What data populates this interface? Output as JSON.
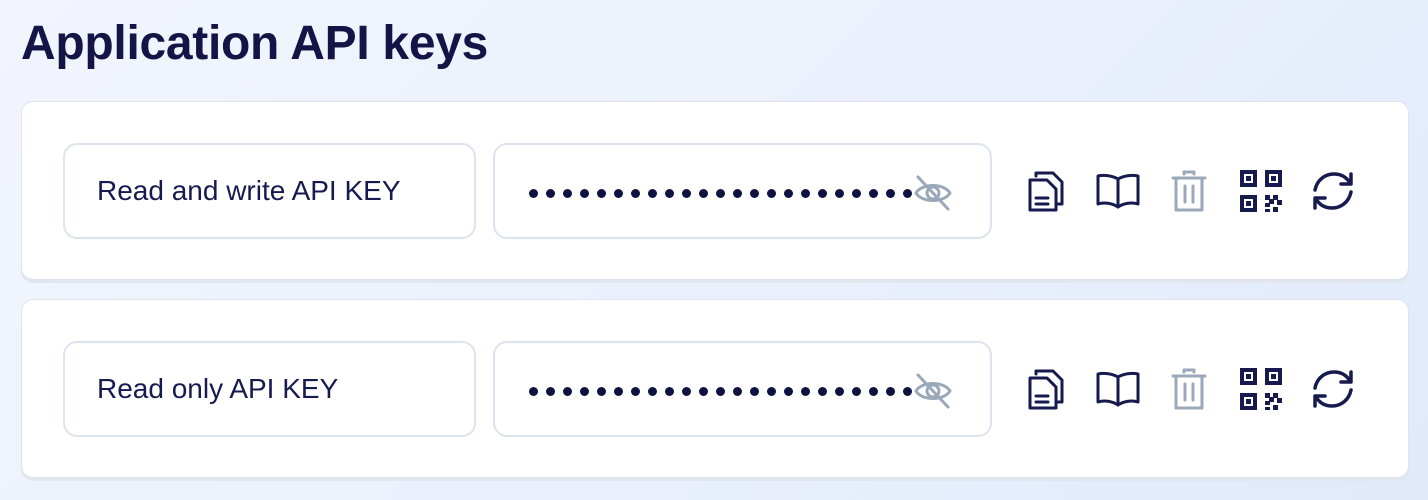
{
  "page": {
    "title": "Application API keys"
  },
  "keys": [
    {
      "name": "Read and write API KEY",
      "masked_value": "•••••••••••••••••••••••••",
      "actions": [
        "copy-icon",
        "book-icon",
        "trash-icon",
        "qr-code-icon",
        "refresh-icon"
      ]
    },
    {
      "name": "Read only API KEY",
      "masked_value": "•••••••••••••••••••••••••",
      "actions": [
        "copy-icon",
        "book-icon",
        "trash-icon",
        "qr-code-icon",
        "refresh-icon"
      ]
    }
  ],
  "icons": {
    "visibility_toggle": "eye-slash-icon"
  },
  "colors": {
    "primary_text": "#141447",
    "muted_icon": "#9aa8ba",
    "border": "#dde4ee",
    "card_bg": "#ffffff"
  }
}
